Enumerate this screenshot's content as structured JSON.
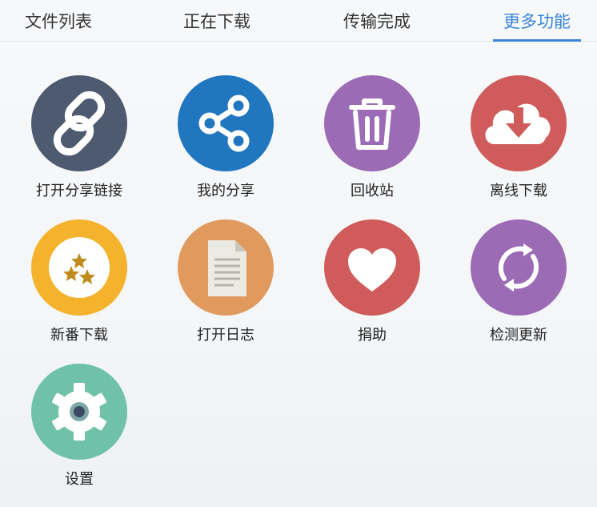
{
  "tabs": [
    {
      "label": "文件列表",
      "active": false
    },
    {
      "label": "正在下载",
      "active": false
    },
    {
      "label": "传输完成",
      "active": false
    },
    {
      "label": "更多功能",
      "active": true
    }
  ],
  "accent_color": "#3a86d6",
  "features": [
    {
      "label": "打开分享链接",
      "icon": "link-icon",
      "color": "#4e5a6f"
    },
    {
      "label": "我的分享",
      "icon": "share-icon",
      "color": "#2176c0"
    },
    {
      "label": "回收站",
      "icon": "trash-icon",
      "color": "#9b6bb5"
    },
    {
      "label": "离线下载",
      "icon": "cloud-download-icon",
      "color": "#cf5c5b"
    },
    {
      "label": "新番下载",
      "icon": "stars-icon",
      "color": "#f5b32d"
    },
    {
      "label": "打开日志",
      "icon": "document-icon",
      "color": "#e09a5e"
    },
    {
      "label": "捐助",
      "icon": "heart-icon",
      "color": "#cf5c5b"
    },
    {
      "label": "检测更新",
      "icon": "refresh-icon",
      "color": "#9b6bb5"
    },
    {
      "label": "设置",
      "icon": "gear-icon",
      "color": "#6fc2a8"
    }
  ]
}
